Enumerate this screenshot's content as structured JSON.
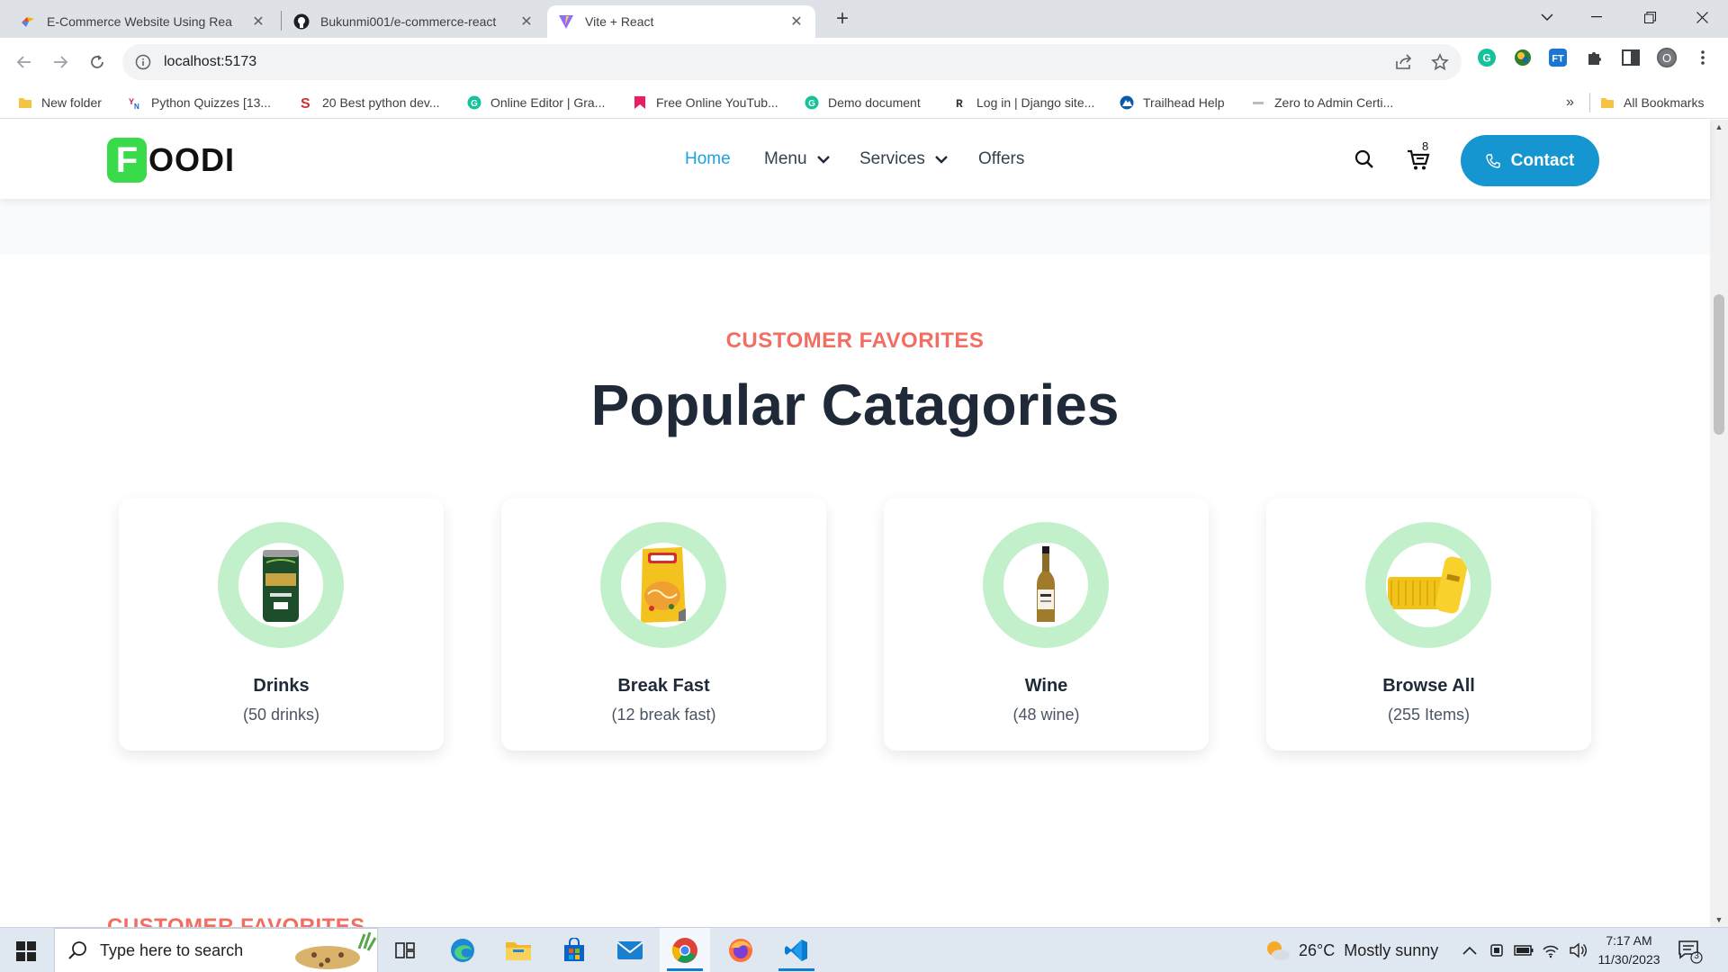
{
  "browser": {
    "tabs": [
      {
        "title": "E-Commerce Website Using Rea",
        "icon": "colorful-bird-icon",
        "active": false
      },
      {
        "title": "Bukunmi001/e-commerce-react",
        "icon": "github-icon",
        "active": false
      },
      {
        "title": "Vite + React",
        "icon": "vite-icon",
        "active": true
      }
    ],
    "url": "localhost:5173",
    "profile_initial": "O",
    "bookmarks": [
      {
        "label": "New folder",
        "icon": "folder-icon"
      },
      {
        "label": "Python Quizzes [13...",
        "icon": "yn-icon"
      },
      {
        "label": "20 Best python dev...",
        "icon": "s-icon"
      },
      {
        "label": "Online Editor | Gra...",
        "icon": "grammarly-icon"
      },
      {
        "label": "Free Online YouTub...",
        "icon": "bookmark-red-icon"
      },
      {
        "label": "Demo document",
        "icon": "grammarly-icon"
      },
      {
        "label": "Log in | Django site...",
        "icon": "django-icon"
      },
      {
        "label": "Trailhead Help",
        "icon": "trailhead-icon"
      },
      {
        "label": "Zero to Admin Certi...",
        "icon": "zero-icon"
      }
    ],
    "bookmarks_more": "»",
    "all_bookmarks": "All Bookmarks"
  },
  "site": {
    "logo_mark": "F",
    "logo_text": "OODI",
    "nav": {
      "home": "Home",
      "menu": "Menu",
      "services": "Services",
      "offers": "Offers"
    },
    "cart_count": "8",
    "contact_label": "Contact",
    "brand_color": "#39db4a",
    "accent_color": "#1596d0",
    "highlight_color": "#f26d62"
  },
  "section": {
    "subtitle": "CUSTOMER FAVORITES",
    "title": "Popular Catagories",
    "categories": [
      {
        "name": "Drinks",
        "count": "(50 drinks)",
        "image": "green-can-drink-image"
      },
      {
        "name": "Break Fast",
        "count": "(12 break fast)",
        "image": "noodle-pack-image"
      },
      {
        "name": "Wine",
        "count": "(48 wine)",
        "image": "whisky-bottle-image"
      },
      {
        "name": "Browse All",
        "count": "(255 Items)",
        "image": "yellow-cans-pack-image"
      }
    ],
    "next_subtitle_peek": "CUSTOMER FAVORITES"
  },
  "taskbar": {
    "search_placeholder": "Type here to search",
    "weather_temp": "26°C",
    "weather_text": "Mostly sunny",
    "time": "7:17 AM",
    "date": "11/30/2023",
    "notification_count": "3"
  }
}
